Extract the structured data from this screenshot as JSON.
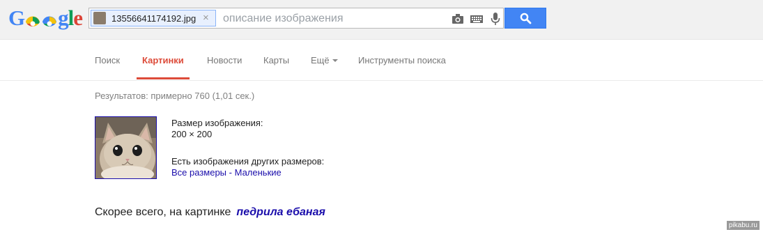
{
  "logo": {
    "text": "Google"
  },
  "search": {
    "chip_filename": "13556641174192.jpg",
    "chip_close": "×",
    "placeholder": "описание изображения"
  },
  "icons": {
    "camera": "camera-icon",
    "keyboard": "keyboard-icon",
    "mic": "mic-icon",
    "search": "search-icon"
  },
  "nav": {
    "items": [
      {
        "label": "Поиск"
      },
      {
        "label": "Картинки",
        "active": true
      },
      {
        "label": "Новости"
      },
      {
        "label": "Карты"
      },
      {
        "label": "Ещё"
      },
      {
        "label": "Инструменты поиска"
      }
    ]
  },
  "results": {
    "stats": "Результатов: примерно 760 (1,01 сек.)",
    "size_label": "Размер изображения:",
    "size_value": "200 × 200",
    "other_sizes_label": "Есть изображения других размеров:",
    "link_all": "Все размеры",
    "link_sep": " - ",
    "link_small": "Маленькие"
  },
  "best_guess": {
    "prefix": "Скорее всего, на картинке",
    "guess": "педрила ебаная"
  },
  "watermark": "pikabu.ru",
  "colors": {
    "accent_red": "#dd4b39",
    "link_blue": "#1a0dab",
    "button_blue": "#4285f4"
  }
}
